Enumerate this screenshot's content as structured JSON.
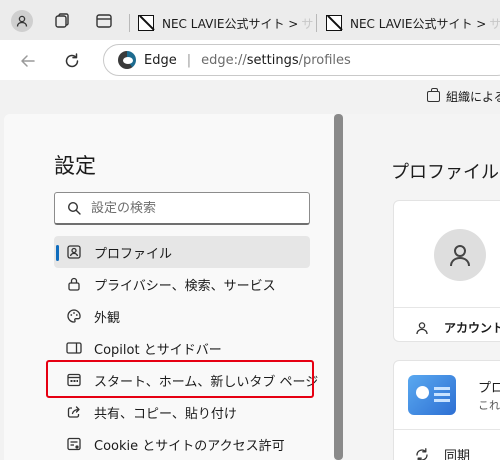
{
  "tabs": [
    {
      "title": "NEC LAVIE公式サイト >",
      "fade": "サ"
    },
    {
      "title": "NEC LAVIE公式サイト >",
      "fade": "サ"
    }
  ],
  "address_bar": {
    "brand": "Edge",
    "scheme": "edge://",
    "host": "settings",
    "path": "/profiles"
  },
  "org_banner": "組織による",
  "sidebar": {
    "title": "設定",
    "search_placeholder": "設定の検索",
    "items": [
      {
        "label": "プロファイル",
        "icon": "profile-icon",
        "active": true
      },
      {
        "label": "プライバシー、検索、サービス",
        "icon": "lock-icon"
      },
      {
        "label": "外観",
        "icon": "palette-icon"
      },
      {
        "label": "Copilot とサイドバー",
        "icon": "sidebar-icon"
      },
      {
        "label": "スタート、ホーム、新しいタブ ページ",
        "icon": "home-tab-icon"
      },
      {
        "label": "共有、コピー、貼り付け",
        "icon": "share-icon"
      },
      {
        "label": "Cookie とサイトのアクセス許可",
        "icon": "site-permissions-icon"
      }
    ]
  },
  "main": {
    "heading": "プロファイル",
    "account_label": "アカウント",
    "promo_title": "プロ",
    "promo_sub": "これら",
    "sync_label": "同期"
  },
  "colors": {
    "accent": "#0f6cbd",
    "highlight": "#e60012"
  }
}
